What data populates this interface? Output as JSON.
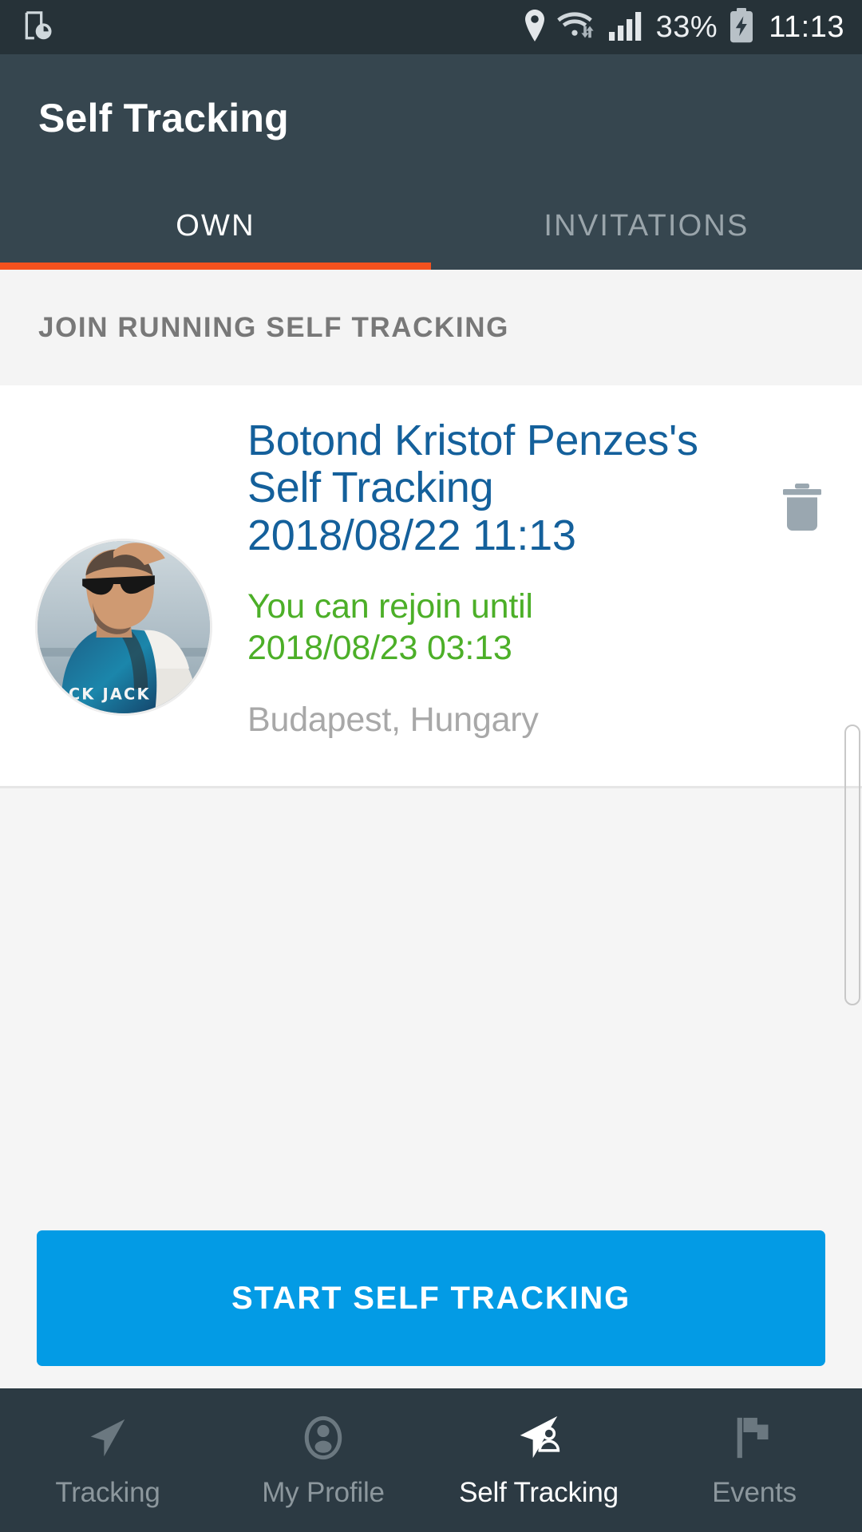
{
  "statusbar": {
    "left_icon": "device-clock-icon",
    "location_icon": "location-pin-icon",
    "wifi_icon": "wifi-icon",
    "signal_icon": "cellular-signal-icon",
    "battery_percent": "33%",
    "battery_icon": "battery-charging-icon",
    "time": "11:13",
    "background": "#263238"
  },
  "appbar": {
    "title": "Self Tracking",
    "background": "#36464f",
    "tabs": [
      {
        "label": "OWN",
        "active": true
      },
      {
        "label": "INVITATIONS",
        "active": false
      }
    ],
    "indicator_color": "#f4511e"
  },
  "section": {
    "header": "JOIN RUNNING SELF TRACKING"
  },
  "card": {
    "avatar_alt": "avatar",
    "title": "Botond Kristof Penzes's Self Tracking 2018/08/22 11:13",
    "title_color": "#14609b",
    "subtitle": "You can rejoin until 2018/08/23 03:13",
    "subtitle_color": "#4caf28",
    "location": "Budapest, Hungary",
    "location_color": "#a8a8a8",
    "delete_icon": "trash-icon"
  },
  "cta": {
    "label": "START SELF TRACKING",
    "color": "#039be5"
  },
  "bottomnav": {
    "background": "#2c3a43",
    "items": [
      {
        "label": "Tracking",
        "icon": "navigation-arrow-icon",
        "active": false
      },
      {
        "label": "My Profile",
        "icon": "person-icon",
        "active": false
      },
      {
        "label": "Self Tracking",
        "icon": "navigation-arrow-person-icon",
        "active": true
      },
      {
        "label": "Events",
        "icon": "flag-icon",
        "active": false
      }
    ]
  }
}
